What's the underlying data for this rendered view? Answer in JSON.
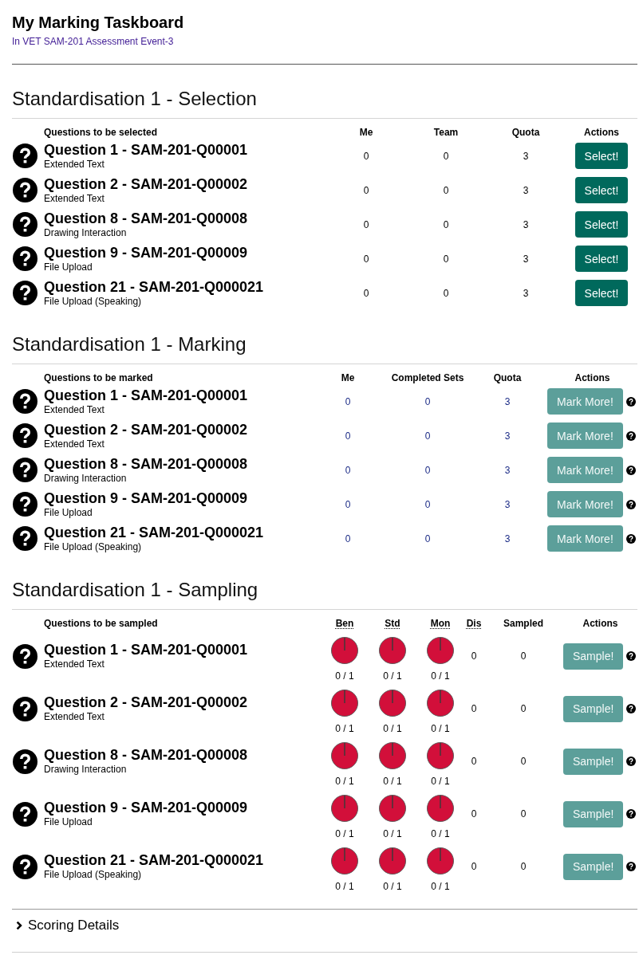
{
  "header": {
    "title": "My Marking Taskboard",
    "subtitle": "In VET SAM-201 Assessment Event-3"
  },
  "sections": [
    {
      "kind": "selection",
      "title": "Standardisation 1 - Selection",
      "columns": [
        "Questions to be selected",
        "Me",
        "Team",
        "Quota",
        "Actions"
      ],
      "rows": [
        {
          "question": "Question 1 - SAM-201-Q00001",
          "type": "Extended Text",
          "values": [
            "0",
            "0",
            "3"
          ],
          "button": {
            "label": "Select!",
            "disabled": false
          }
        },
        {
          "question": "Question 2 - SAM-201-Q00002",
          "type": "Extended Text",
          "values": [
            "0",
            "0",
            "3"
          ],
          "button": {
            "label": "Select!",
            "disabled": false
          }
        },
        {
          "question": "Question 8 - SAM-201-Q00008",
          "type": "Drawing Interaction",
          "values": [
            "0",
            "0",
            "3"
          ],
          "button": {
            "label": "Select!",
            "disabled": false
          }
        },
        {
          "question": "Question 9 - SAM-201-Q00009",
          "type": "File Upload",
          "values": [
            "0",
            "0",
            "3"
          ],
          "button": {
            "label": "Select!",
            "disabled": false
          }
        },
        {
          "question": "Question 21 - SAM-201-Q000021",
          "type": "File Upload (Speaking)",
          "values": [
            "0",
            "0",
            "3"
          ],
          "button": {
            "label": "Select!",
            "disabled": false
          }
        }
      ]
    },
    {
      "kind": "marking",
      "title": "Standardisation 1 - Marking",
      "columns": [
        "Questions to be marked",
        "Me",
        "Completed Sets",
        "Quota",
        "Actions"
      ],
      "rows": [
        {
          "question": "Question 1 - SAM-201-Q00001",
          "type": "Extended Text",
          "values": [
            "0",
            "0",
            "3"
          ],
          "button": {
            "label": "Mark More!",
            "disabled": true
          }
        },
        {
          "question": "Question 2 - SAM-201-Q00002",
          "type": "Extended Text",
          "values": [
            "0",
            "0",
            "3"
          ],
          "button": {
            "label": "Mark More!",
            "disabled": true
          }
        },
        {
          "question": "Question 8 - SAM-201-Q00008",
          "type": "Drawing Interaction",
          "values": [
            "0",
            "0",
            "3"
          ],
          "button": {
            "label": "Mark More!",
            "disabled": true
          }
        },
        {
          "question": "Question 9 - SAM-201-Q00009",
          "type": "File Upload",
          "values": [
            "0",
            "0",
            "3"
          ],
          "button": {
            "label": "Mark More!",
            "disabled": true
          }
        },
        {
          "question": "Question 21 - SAM-201-Q000021",
          "type": "File Upload (Speaking)",
          "values": [
            "0",
            "0",
            "3"
          ],
          "button": {
            "label": "Mark More!",
            "disabled": true
          }
        }
      ]
    },
    {
      "kind": "sampling",
      "title": "Standardisation 1 - Sampling",
      "columns": [
        "Questions to be sampled",
        "Ben",
        "Std",
        "Mon",
        "Dis",
        "Sampled",
        "Actions"
      ],
      "rows": [
        {
          "question": "Question 1 - SAM-201-Q00001",
          "type": "Extended Text",
          "readings": [
            "0 / 1",
            "0 / 1",
            "0 / 1"
          ],
          "values": [
            "0",
            "0"
          ],
          "button": {
            "label": "Sample!",
            "disabled": true
          }
        },
        {
          "question": "Question 2 - SAM-201-Q00002",
          "type": "Extended Text",
          "readings": [
            "0 / 1",
            "0 / 1",
            "0 / 1"
          ],
          "values": [
            "0",
            "0"
          ],
          "button": {
            "label": "Sample!",
            "disabled": true
          }
        },
        {
          "question": "Question 8 - SAM-201-Q00008",
          "type": "Drawing Interaction",
          "readings": [
            "0 / 1",
            "0 / 1",
            "0 / 1"
          ],
          "values": [
            "0",
            "0"
          ],
          "button": {
            "label": "Sample!",
            "disabled": true
          }
        },
        {
          "question": "Question 9 - SAM-201-Q00009",
          "type": "File Upload",
          "readings": [
            "0 / 1",
            "0 / 1",
            "0 / 1"
          ],
          "values": [
            "0",
            "0"
          ],
          "button": {
            "label": "Sample!",
            "disabled": true
          }
        },
        {
          "question": "Question 21 - SAM-201-Q000021",
          "type": "File Upload (Speaking)",
          "readings": [
            "0 / 1",
            "0 / 1",
            "0 / 1"
          ],
          "values": [
            "0",
            "0"
          ],
          "button": {
            "label": "Sample!",
            "disabled": true
          }
        }
      ]
    }
  ],
  "collapsible": {
    "label": "Scoring Details",
    "expanded": false
  }
}
